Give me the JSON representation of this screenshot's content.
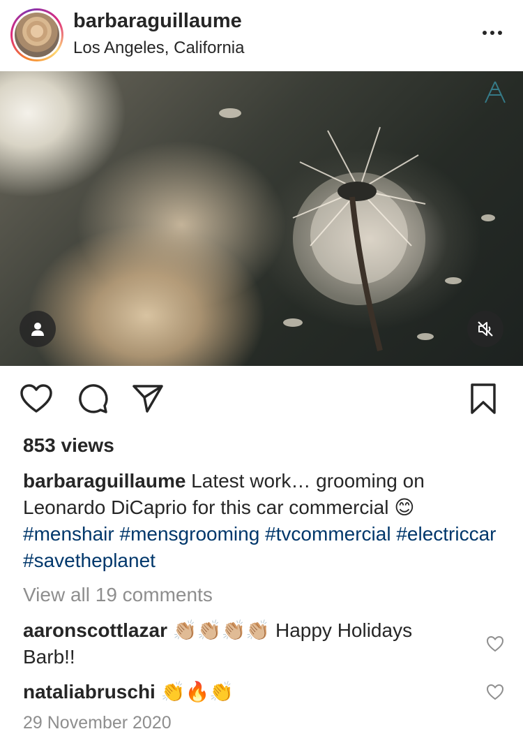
{
  "post": {
    "username": "barbaraguillaume",
    "location": "Los Angeles, California"
  },
  "icons": {
    "more": "more-horizontal-icon",
    "user_tag": "user-icon",
    "mute": "speaker-muted-icon",
    "like": "heart-icon",
    "comment": "comment-bubble-icon",
    "share": "paper-plane-icon",
    "save": "bookmark-icon"
  },
  "stats": {
    "views": "853 views"
  },
  "caption": {
    "username": "barbaraguillaume",
    "text": " Latest work… grooming on Leonardo DiCaprio for this car commercial 😊 ",
    "hashtags": [
      "#menshair",
      "#mensgrooming",
      "#tvcommercial",
      "#electriccar",
      "#savetheplanet"
    ]
  },
  "comments_link": "View all 19 comments",
  "comments": [
    {
      "username": "aaronscottlazar",
      "text": " 👏🏼👏🏼👏🏼👏🏼 Happy Holidays Barb!!"
    },
    {
      "username": "nataliabruschi",
      "text": " 👏🔥👏"
    }
  ],
  "date": "29 November 2020",
  "colors": {
    "text": "#262626",
    "hashtag": "#00376b",
    "muted": "#8e8e8e",
    "story_ring": [
      "#f58529",
      "#dd2a7b",
      "#8134af",
      "#feda77"
    ]
  }
}
